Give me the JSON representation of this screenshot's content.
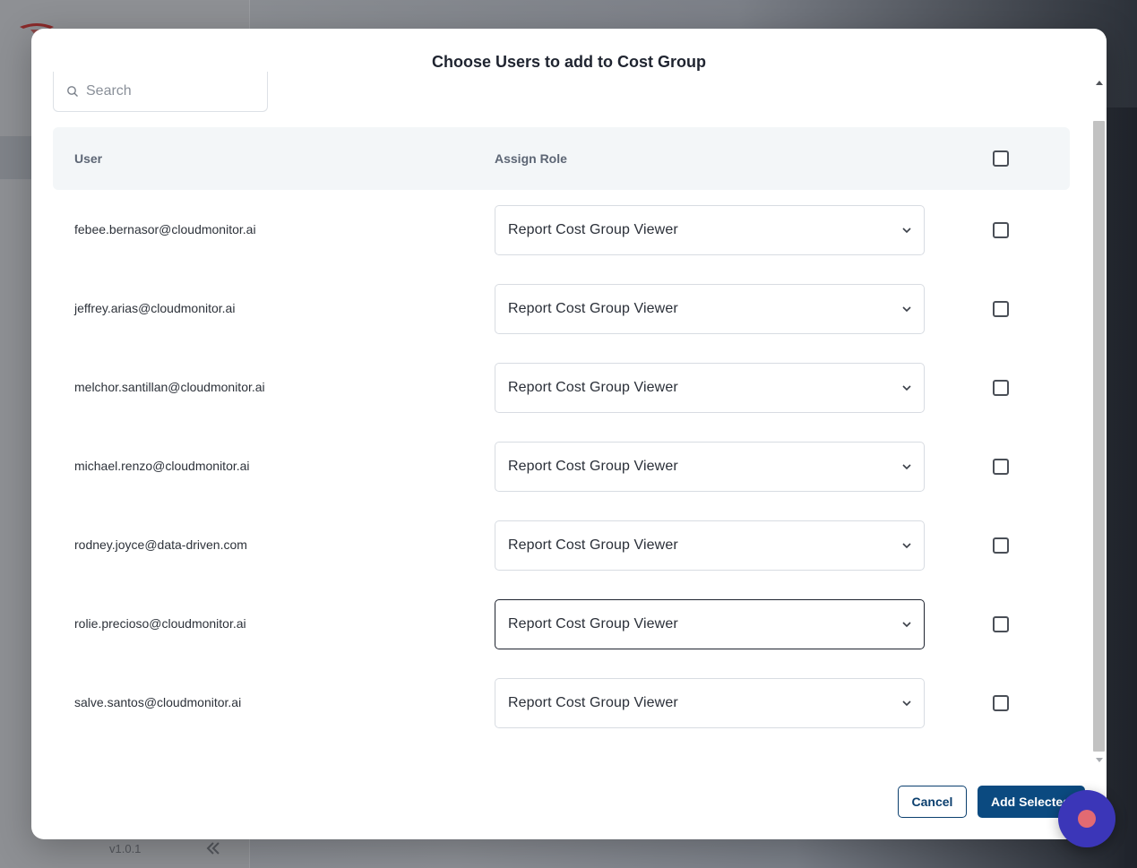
{
  "background": {
    "version": "v1.0.1"
  },
  "modal": {
    "title": "Choose Users to add to Cost Group",
    "search": {
      "placeholder": "Search",
      "value": ""
    },
    "table": {
      "columns": {
        "user": "User",
        "role": "Assign Role"
      },
      "rows": [
        {
          "email": "febee.bernasor@cloudmonitor.ai",
          "role": "Report Cost Group Viewer",
          "checked": false
        },
        {
          "email": "jeffrey.arias@cloudmonitor.ai",
          "role": "Report Cost Group Viewer",
          "checked": false
        },
        {
          "email": "melchor.santillan@cloudmonitor.ai",
          "role": "Report Cost Group Viewer",
          "checked": false
        },
        {
          "email": "michael.renzo@cloudmonitor.ai",
          "role": "Report Cost Group Viewer",
          "checked": false
        },
        {
          "email": "rodney.joyce@data-driven.com",
          "role": "Report Cost Group Viewer",
          "checked": false
        },
        {
          "email": "rolie.precioso@cloudmonitor.ai",
          "role": "Report Cost Group Viewer",
          "checked": false,
          "focused": true
        },
        {
          "email": "salve.santos@cloudmonitor.ai",
          "role": "Report Cost Group Viewer",
          "checked": false
        }
      ]
    },
    "buttons": {
      "cancel": "Cancel",
      "add_selected": "Add Selected"
    }
  },
  "icons": {
    "search": "search-icon",
    "chevron": "chevron-down-icon",
    "collapse": "double-chevron-left-icon",
    "chat": "chat-widget-icon"
  },
  "colors": {
    "primary": "#0b4a80",
    "header_bg": "#f3f6f8",
    "widget": "#3b36b8",
    "widget_dot": "#e26a72"
  }
}
